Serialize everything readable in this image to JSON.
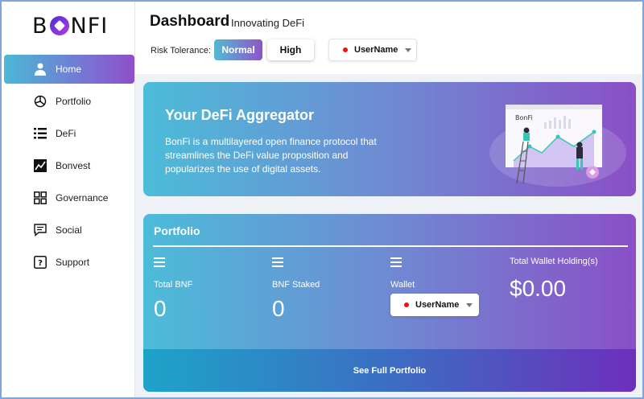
{
  "brand": {
    "logo_left": "B",
    "logo_right": "NFI"
  },
  "sidebar": {
    "items": [
      {
        "label": "Home",
        "icon": "user-icon",
        "active": true
      },
      {
        "label": "Portfolio",
        "icon": "pie-chart-icon"
      },
      {
        "label": "DeFi",
        "icon": "list-icon"
      },
      {
        "label": "Bonvest",
        "icon": "line-chart-icon"
      },
      {
        "label": "Governance",
        "icon": "grid-icon"
      },
      {
        "label": "Social",
        "icon": "chat-icon"
      },
      {
        "label": "Support",
        "icon": "question-icon"
      }
    ]
  },
  "header": {
    "title": "Dashboard",
    "subtitle": "Innovating DeFi",
    "risk_label": "Risk Tolerance:",
    "risk_options": [
      "Normal",
      "High"
    ],
    "risk_selected": "Normal",
    "user_dropdown": "UserName"
  },
  "hero": {
    "title": "Your DeFi Aggregator",
    "text": "BonFi is a multilayered open finance protocol that streamlines the DeFi value proposition and popularizes the use of digital assets.",
    "illustration_label": "BonFi"
  },
  "portfolio": {
    "title": "Portfolio",
    "total_bnf_label": "Total BNF",
    "total_bnf_value": "0",
    "bnf_staked_label": "BNF Staked",
    "bnf_staked_value": "0",
    "wallet_label": "Wallet",
    "wallet_dropdown": "UserName",
    "holding_label": "Total Wallet Holding(s)",
    "holding_value": "$0.00",
    "see_full_label": "See Full Portfolio"
  },
  "colors": {
    "accent_start": "#4cbcd8",
    "accent_end": "#8a4fc6",
    "status_dot": "#ee1111"
  }
}
